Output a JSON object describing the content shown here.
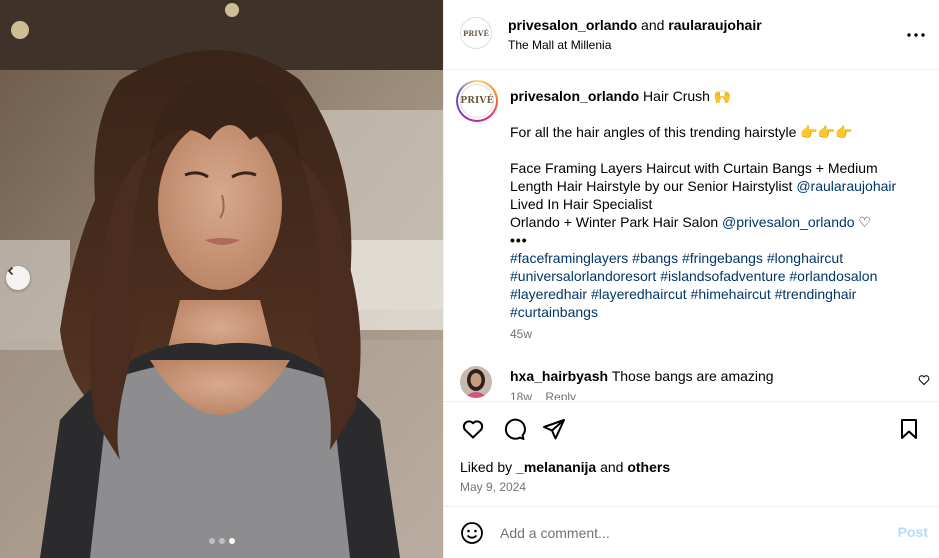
{
  "post": {
    "media_alt": "woman with face framing layers and curtain bangs",
    "carousel": {
      "count": 3,
      "active_index": 2
    },
    "header": {
      "account1": "privesalon_orlando",
      "and_text": "and",
      "account2": "raularaujohair",
      "location": "The Mall at Millenia",
      "avatar_logo_text": "PRIVÉ"
    },
    "caption": {
      "username": "privesalon_orlando",
      "title": "Hair Crush 🙌",
      "line1": "For all the hair angles of this trending hairstyle 👉👉👉",
      "line2": "Face Framing Layers Haircut with Curtain Bangs + Medium",
      "line3_prefix": "Length Hair Hairstyle by our Senior Hairstylist ",
      "line3_mention": "@raularaujohair",
      "line4": "Lived In Hair Specialist",
      "line5_prefix": "Orlando + Winter Park Hair Salon ",
      "line5_mention": "@privesalon_orlando",
      "line5_suffix": " ♡",
      "ellipsis": "•••",
      "hashtags_line1": "#faceframinglayers #bangs #fringebangs #longhaircut",
      "hashtags_line2": "#universalorlandoresort #islandsofadventure #orlandosalon",
      "hashtags_line3": "#layeredhair #layeredhaircut #himehaircut #trendinghair",
      "hashtags_line4": "#curtainbangs",
      "age": "45w",
      "avatar_logo_text": "PRIVÉ"
    },
    "comments": [
      {
        "username": "hxa_hairbyash",
        "text": " Those bangs are amazing",
        "age": "18w",
        "reply_label": "Reply"
      }
    ],
    "actions": {
      "like_icon": "heart-icon",
      "comment_icon": "comment-icon",
      "share_icon": "share-icon",
      "save_icon": "bookmark-icon"
    },
    "likes": {
      "prefix": "Liked by ",
      "user": "_melananija",
      "middle": " and ",
      "others": "others"
    },
    "date": "May 9, 2024",
    "add_comment": {
      "placeholder": "Add a comment...",
      "post_label": "Post"
    }
  }
}
